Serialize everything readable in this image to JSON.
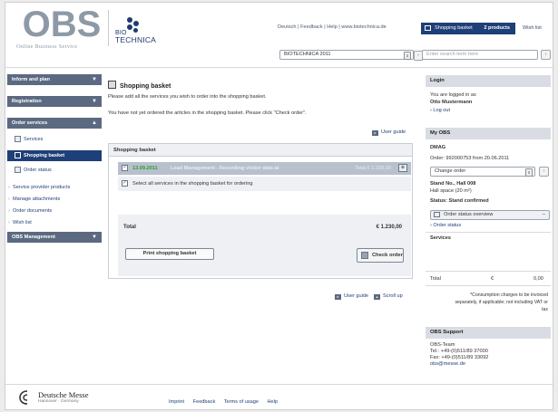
{
  "header": {
    "logo_obs": "OBS",
    "logo_obs_sub": "Online Business Service",
    "logo_bt_top": "BIO",
    "logo_bt_bottom": "TECHNICA",
    "top_links": "Deutsch | Feedback | Help | www.biotechnica.de",
    "event_select_value": "BIOTECHNICA 2011",
    "basket_label": "Shopping basket",
    "basket_count": "2 products",
    "wish_list": "Wish list",
    "search_placeholder": "Enter search term here"
  },
  "sidebar": {
    "sections": [
      {
        "label": "Inform and plan",
        "caret": "▼"
      },
      {
        "label": "Registration",
        "caret": "▼"
      },
      {
        "label": "Order services",
        "caret": "▲"
      }
    ],
    "order_items": [
      {
        "label": "Services"
      },
      {
        "label": "Shopping basket"
      },
      {
        "label": "Order status"
      }
    ],
    "links": [
      "Service provider products",
      "Manage attachments",
      "Order documents",
      "Wish list"
    ],
    "bottom_section": {
      "label": "OBS Management",
      "caret": "▼"
    }
  },
  "main": {
    "title": "Shopping basket",
    "intro": "Please add all the services you wish to order into the shopping basket.",
    "notice": "You have not yet ordered the articles in the shopping basket. Please click \"Check order\".",
    "user_guide": "User guide",
    "basket": {
      "header": "Shopping basket",
      "row_date": "13.09.2011",
      "row_desc": "Lead Management - Recording visitor data at",
      "row_total": "Total € 1.230,00",
      "select_all": "Select all services in the shopping basket for ordering",
      "total_label": "Total",
      "total_value": "€ 1.230,00",
      "print_button": "Print shopping basket",
      "check_button": "Check order"
    },
    "bottom_user_guide": "User guide",
    "scroll_up": "Scroll up"
  },
  "right": {
    "login_title": "Login",
    "logged_in_as": "You are logged in as",
    "user_name": "Otto Mustermann",
    "logout": "› Log out",
    "myobs_title": "My OBS",
    "company": "DMAG",
    "order_line": "Order: 992000753 from 20.06.2011",
    "change_order": "Change order",
    "stand": "Stand No., Hall 008",
    "stand_space": "Hall space (20 m²)",
    "status": "Status: Stand confirmed",
    "order_status_overview": "Order status overview",
    "order_status_link": "› Order status",
    "services_label": "Services",
    "total_label": "Total",
    "total_currency": "€",
    "total_value": "0,00",
    "consumption_note_1": "*Consumption charges to be invoiced",
    "consumption_note_2": "separately, if applicable; not including VAT or",
    "consumption_note_3": "tax",
    "support_title": "OBS Support",
    "support_team": "OBS-Team",
    "support_tel": "Tel.: +49-(0)511/89 37000",
    "support_fax": "Fax: +49-(0)511/89 33092",
    "support_email": "obs@messe.de"
  },
  "footer": {
    "company": "Deutsche Messe",
    "location": "Hannover · Germany",
    "links": [
      "Imprint",
      "Feedback",
      "Terms of usage",
      "Help"
    ]
  }
}
